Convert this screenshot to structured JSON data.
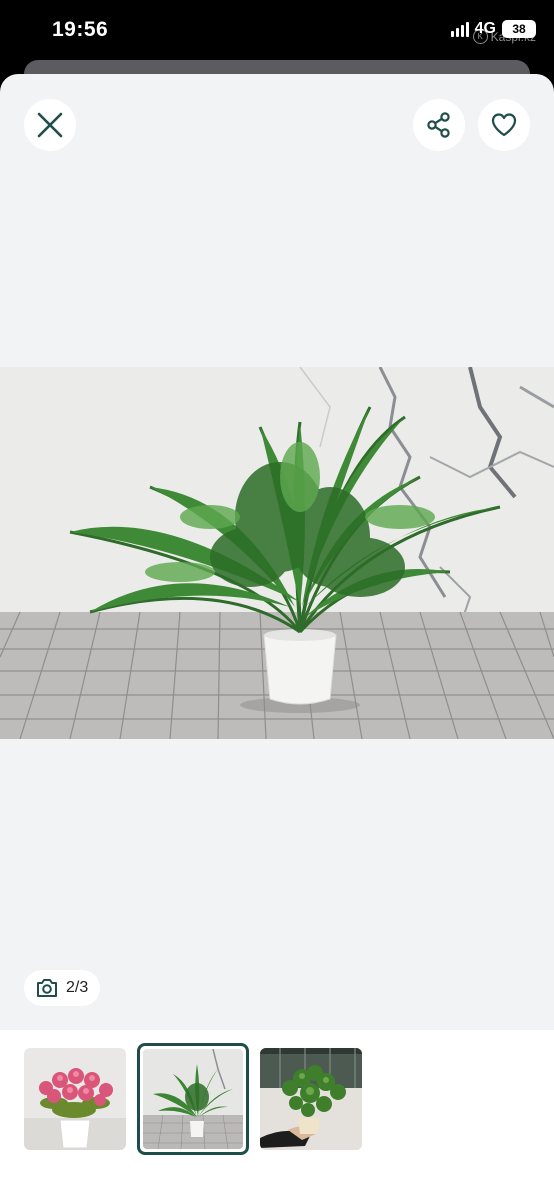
{
  "status_bar": {
    "time": "19:56",
    "network": "4G",
    "battery": "38",
    "watermark": "Kaspi.kz"
  },
  "header": {
    "close_icon": "close-icon",
    "share_icon": "share-icon",
    "favorite_icon": "heart-icon"
  },
  "gallery": {
    "counter": "2/3",
    "counter_icon": "camera-icon",
    "selected_index": 2,
    "thumbnails": [
      {
        "name": "thumbnail-pink-roses",
        "icon": "pink-flower-pot"
      },
      {
        "name": "thumbnail-fern",
        "icon": "fern-pot"
      },
      {
        "name": "thumbnail-plant-in-hand",
        "icon": "plant-in-hand"
      }
    ]
  },
  "colors": {
    "modal_bg": "#f2f3f5",
    "selected_border": "#1f4e4a",
    "icon_color": "#1f4e4a"
  }
}
